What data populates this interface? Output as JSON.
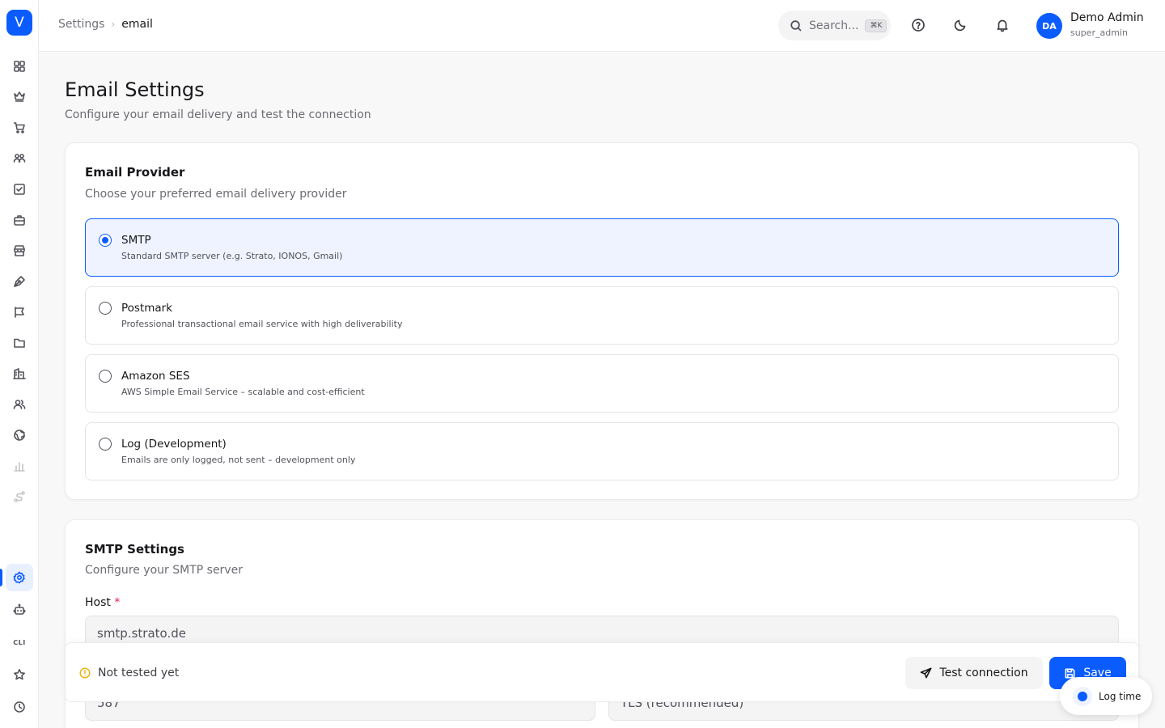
{
  "app": {
    "logo_letter": "V"
  },
  "sidebar": {
    "items": [
      {
        "icon": "grid-icon"
      },
      {
        "icon": "crown-icon"
      },
      {
        "icon": "cart-icon"
      },
      {
        "icon": "users-icon"
      },
      {
        "icon": "checkbox-icon"
      },
      {
        "icon": "briefcase-icon"
      },
      {
        "icon": "store-icon"
      },
      {
        "icon": "pen-icon"
      },
      {
        "icon": "megaphone-icon"
      },
      {
        "icon": "folder-icon"
      },
      {
        "icon": "building-icon"
      },
      {
        "icon": "team-icon"
      },
      {
        "icon": "globe-icon"
      },
      {
        "icon": "chart-icon"
      },
      {
        "icon": "route-icon"
      },
      {
        "icon": "gear-icon",
        "active": true
      },
      {
        "icon": "robot-icon"
      },
      {
        "icon": "cli-icon",
        "label": "CLI"
      },
      {
        "icon": "star-icon"
      },
      {
        "icon": "clock-icon"
      }
    ]
  },
  "header": {
    "breadcrumb": {
      "parent": "Settings",
      "current": "email"
    },
    "search": {
      "placeholder": "Search...",
      "shortcut": "⌘K"
    },
    "user": {
      "initials": "DA",
      "name": "Demo Admin",
      "role": "super_admin"
    }
  },
  "page": {
    "title": "Email Settings",
    "subtitle": "Configure your email delivery and test the connection"
  },
  "provider_card": {
    "title": "Email Provider",
    "subtitle": "Choose your preferred email delivery provider",
    "options": [
      {
        "name": "SMTP",
        "description": "Standard SMTP server (e.g. Strato, IONOS, Gmail)",
        "selected": true
      },
      {
        "name": "Postmark",
        "description": "Professional transactional email service with high deliverability",
        "selected": false
      },
      {
        "name": "Amazon SES",
        "description": "AWS Simple Email Service – scalable and cost-efficient",
        "selected": false
      },
      {
        "name": "Log (Development)",
        "description": "Emails are only logged, not sent – development only",
        "selected": false
      }
    ]
  },
  "smtp_card": {
    "title": "SMTP Settings",
    "subtitle": "Configure your SMTP server",
    "host_label": "Host",
    "host_required": "*",
    "host_value": "smtp.strato.de",
    "port_value": "587",
    "encryption_value": "TLS (recommended)"
  },
  "footer": {
    "status": "Not tested yet",
    "test_button": "Test connection",
    "save_button": "Save"
  },
  "log_time": {
    "label": "Log time"
  },
  "colors": {
    "accent": "#0a5cff",
    "warning": "#eab308",
    "required": "#e11d48"
  }
}
